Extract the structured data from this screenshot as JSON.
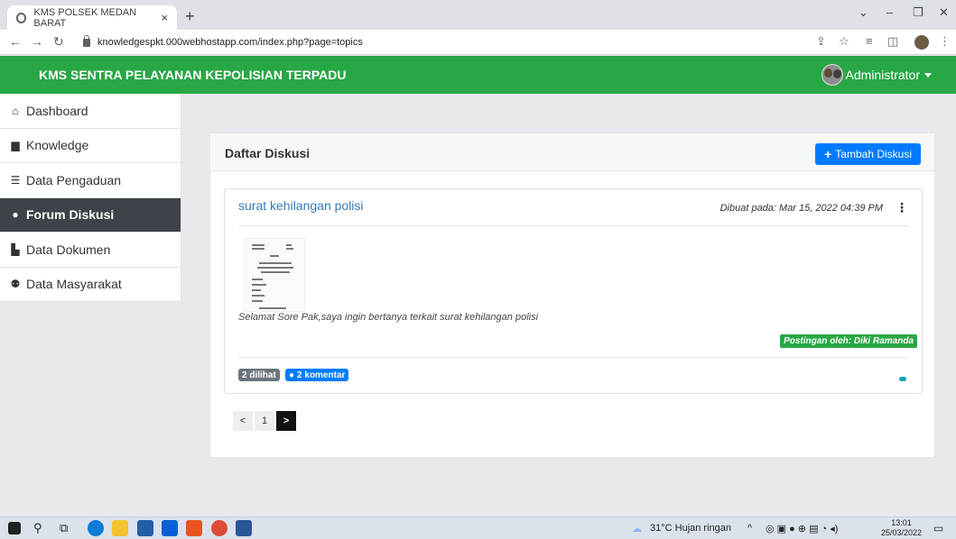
{
  "browser": {
    "tab_title": "KMS POLSEK MEDAN BARAT",
    "tab_close": "×",
    "new_tab": "+",
    "url": "knowledgespkt.000webhostapp.com/index.php?page=topics"
  },
  "header": {
    "brand": "KMS SENTRA PELAYANAN KEPOLISIAN TERPADU",
    "user_name": "Administrator"
  },
  "sidebar": {
    "items": [
      {
        "label": "Dashboard",
        "icon": "home-icon",
        "active": false
      },
      {
        "label": "Knowledge",
        "icon": "book-icon",
        "active": false
      },
      {
        "label": "Data Pengaduan",
        "icon": "bars-icon",
        "active": false
      },
      {
        "label": "Forum Diskusi",
        "icon": "comments-icon",
        "active": true
      },
      {
        "label": "Data Dokumen",
        "icon": "file-icon",
        "active": false
      },
      {
        "label": "Data Masyarakat",
        "icon": "users-icon",
        "active": false
      }
    ]
  },
  "main": {
    "title": "Daftar Diskusi",
    "add_button": "Tambah Diskusi",
    "post": {
      "title": "surat kehilangan polisi",
      "created": "Dibuat pada: Mar 15, 2022 04:39 PM",
      "body": "Selamat Sore Pak,saya ingin bertanya terkait surat kehilangan polisi",
      "author": "Postingan oleh: Diki Ramanda",
      "views": "2 dilihat",
      "comments": "2 komentar"
    },
    "pagination": {
      "prev": "<",
      "current": "1",
      "next": ">"
    }
  },
  "taskbar": {
    "weather": "31°C  Hujan ringan",
    "time": "13:01",
    "date": "25/03/2022"
  },
  "colors": {
    "header_green": "#28a745",
    "primary_blue": "#007bff",
    "sidebar_active": "#3d4349"
  }
}
